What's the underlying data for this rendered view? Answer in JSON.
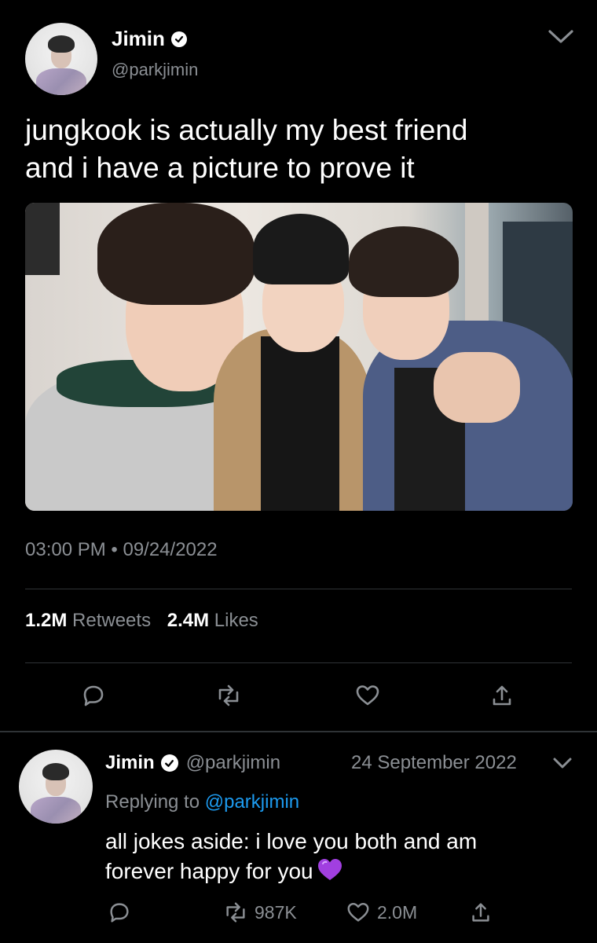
{
  "tweet": {
    "author": {
      "name": "Jimin",
      "handle": "@parkjimin",
      "verified": true
    },
    "text_line1": "jungkook is actually my best friend",
    "text_line2": "and i have a picture to prove it",
    "timestamp": "03:00 PM • 09/24/2022",
    "stats": {
      "retweets_count": "1.2M",
      "retweets_label": "Retweets",
      "likes_count": "2.4M",
      "likes_label": "Likes"
    },
    "actions": [
      "reply-icon",
      "retweet-icon",
      "heart-icon",
      "share-icon"
    ]
  },
  "reply": {
    "author": {
      "name": "Jimin",
      "handle": "@parkjimin",
      "verified": true
    },
    "date": "24 September 2022",
    "replying_prefix": "Replying to",
    "replying_mention": "@parkjimin",
    "text_line1": "all jokes aside: i love you both and am",
    "text_line2": "forever happy for you",
    "emoji": "purple-heart",
    "retweets": "987K",
    "likes": "2.0M"
  },
  "colors": {
    "background": "#000000",
    "text": "#ffffff",
    "secondary": "#8b8f94",
    "link": "#1d9bf0",
    "divider": "#2f3336",
    "emoji_heart": "#a13fe0"
  }
}
